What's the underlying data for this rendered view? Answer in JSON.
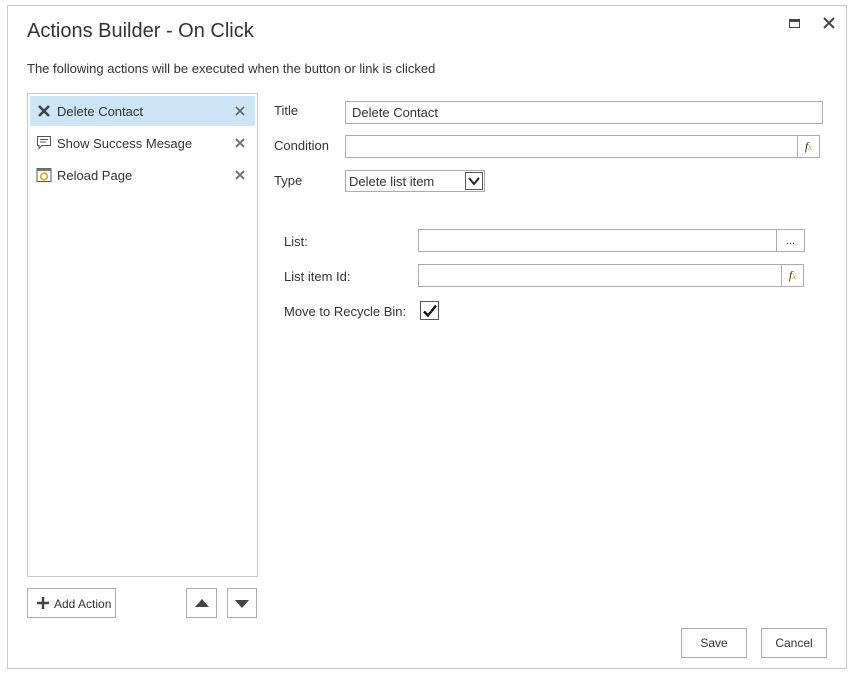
{
  "dialog": {
    "title": "Actions Builder - On Click",
    "subtitle": "The following actions will be executed when the button or link is clicked"
  },
  "actions": [
    {
      "label": "Delete Contact",
      "icon": "delete-x-icon",
      "selected": true
    },
    {
      "label": "Show Success Mesage",
      "icon": "message-icon",
      "selected": false
    },
    {
      "label": "Reload Page",
      "icon": "reload-page-icon",
      "selected": false
    }
  ],
  "toolbar": {
    "add_action_label": "Add Action"
  },
  "form": {
    "title_label": "Title",
    "title_value": "Delete Contact",
    "condition_label": "Condition",
    "condition_value": "",
    "type_label": "Type",
    "type_value": "Delete list item",
    "list_label": "List:",
    "list_value": "",
    "list_button": "...",
    "list_item_id_label": "List item Id:",
    "list_item_id_value": "",
    "recycle_label": "Move to Recycle Bin:",
    "recycle_checked": true,
    "fx_symbol": "f",
    "fx_sub": "x"
  },
  "footer": {
    "save_label": "Save",
    "cancel_label": "Cancel"
  },
  "colors": {
    "selected_bg": "#cde6f7",
    "border": "#ababab",
    "fx_accent": "#d9a400"
  }
}
